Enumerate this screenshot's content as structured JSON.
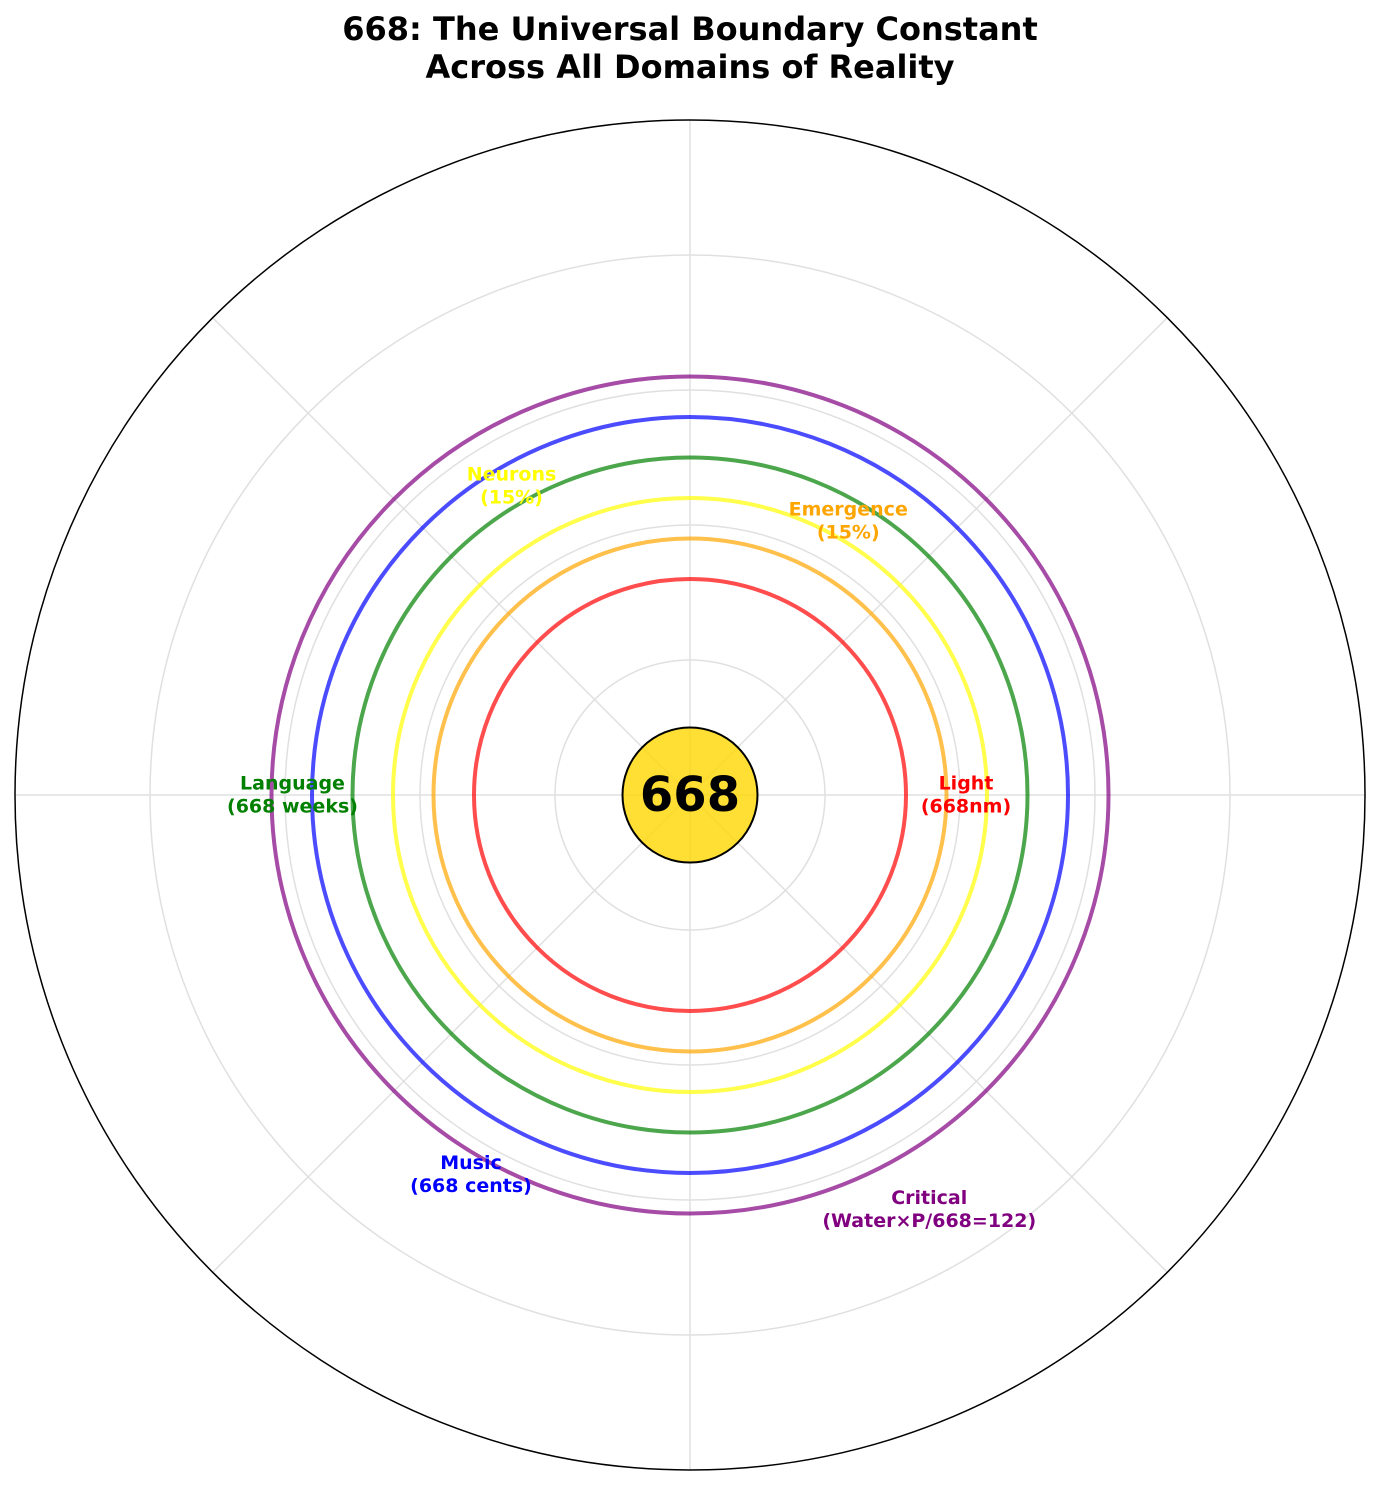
{
  "chart_data": {
    "type": "polar",
    "title_line1": "668: The Universal Boundary Constant",
    "title_line2": "Across All Domains of Reality",
    "center_label": "668",
    "center_color": "#FFD700",
    "rlim": [
      0,
      2.5
    ],
    "grid": true,
    "series": [
      {
        "name": "Light",
        "label": "Light\n(668nm)",
        "radius": 0.8,
        "angle_deg": 0,
        "color": "#FF0000"
      },
      {
        "name": "Emergence",
        "label": "Emergence\n(15%)",
        "radius": 0.95,
        "angle_deg": 60,
        "color": "#FFA500"
      },
      {
        "name": "Neurons",
        "label": "Neurons\n(15%)",
        "radius": 1.1,
        "angle_deg": 120,
        "color": "#FFFF00"
      },
      {
        "name": "Language",
        "label": "Language\n(668 weeks)",
        "radius": 1.25,
        "angle_deg": 180,
        "color": "#008000"
      },
      {
        "name": "Music",
        "label": "Music\n(668 cents)",
        "radius": 1.4,
        "angle_deg": 240,
        "color": "#0000FF"
      },
      {
        "name": "Critical",
        "label": "Critical\n(Water×P/668=122)",
        "radius": 1.55,
        "angle_deg": 300,
        "color": "#800080"
      }
    ]
  }
}
